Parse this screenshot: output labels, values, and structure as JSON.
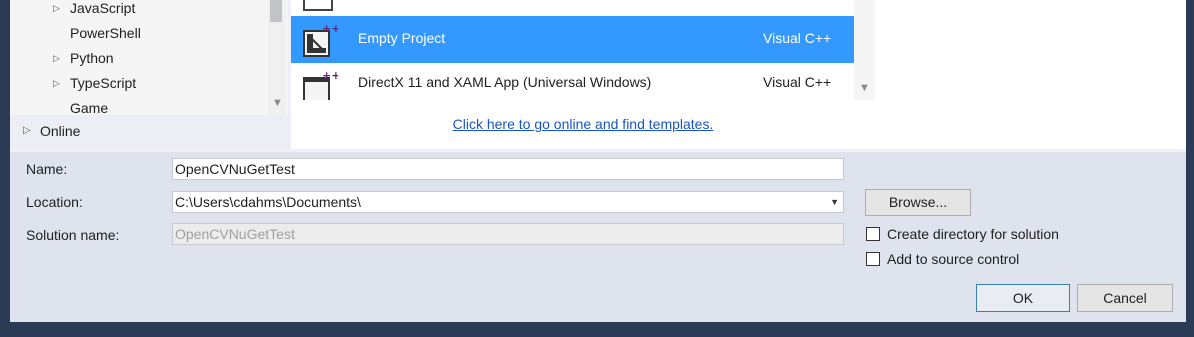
{
  "tree": {
    "items": [
      {
        "label": "JavaScript",
        "expandable": true
      },
      {
        "label": "PowerShell",
        "expandable": false
      },
      {
        "label": "Python",
        "expandable": true
      },
      {
        "label": "TypeScript",
        "expandable": true
      },
      {
        "label": "Game",
        "expandable": false
      }
    ],
    "online_label": "Online"
  },
  "templates": {
    "items": [
      {
        "name": "Empty Project",
        "language": "Visual C++",
        "selected": true
      },
      {
        "name": "DirectX 11 and XAML App (Universal Windows)",
        "language": "Visual C++",
        "selected": false
      }
    ],
    "online_link": "Click here to go online and find templates."
  },
  "form": {
    "name_label": "Name:",
    "name_value": "OpenCVNuGetTest",
    "location_label": "Location:",
    "location_value": "C:\\Users\\cdahms\\Documents\\",
    "solution_label": "Solution name:",
    "solution_value": "OpenCVNuGetTest",
    "browse_label": "Browse...",
    "create_dir_label": "Create directory for solution",
    "source_control_label": "Add to source control",
    "ok_label": "OK",
    "cancel_label": "Cancel"
  },
  "colors": {
    "selection": "#3399ff",
    "link": "#1a55c4",
    "dialog_bg": "#dfe3ee",
    "desktop_bg": "#2b3a55"
  }
}
